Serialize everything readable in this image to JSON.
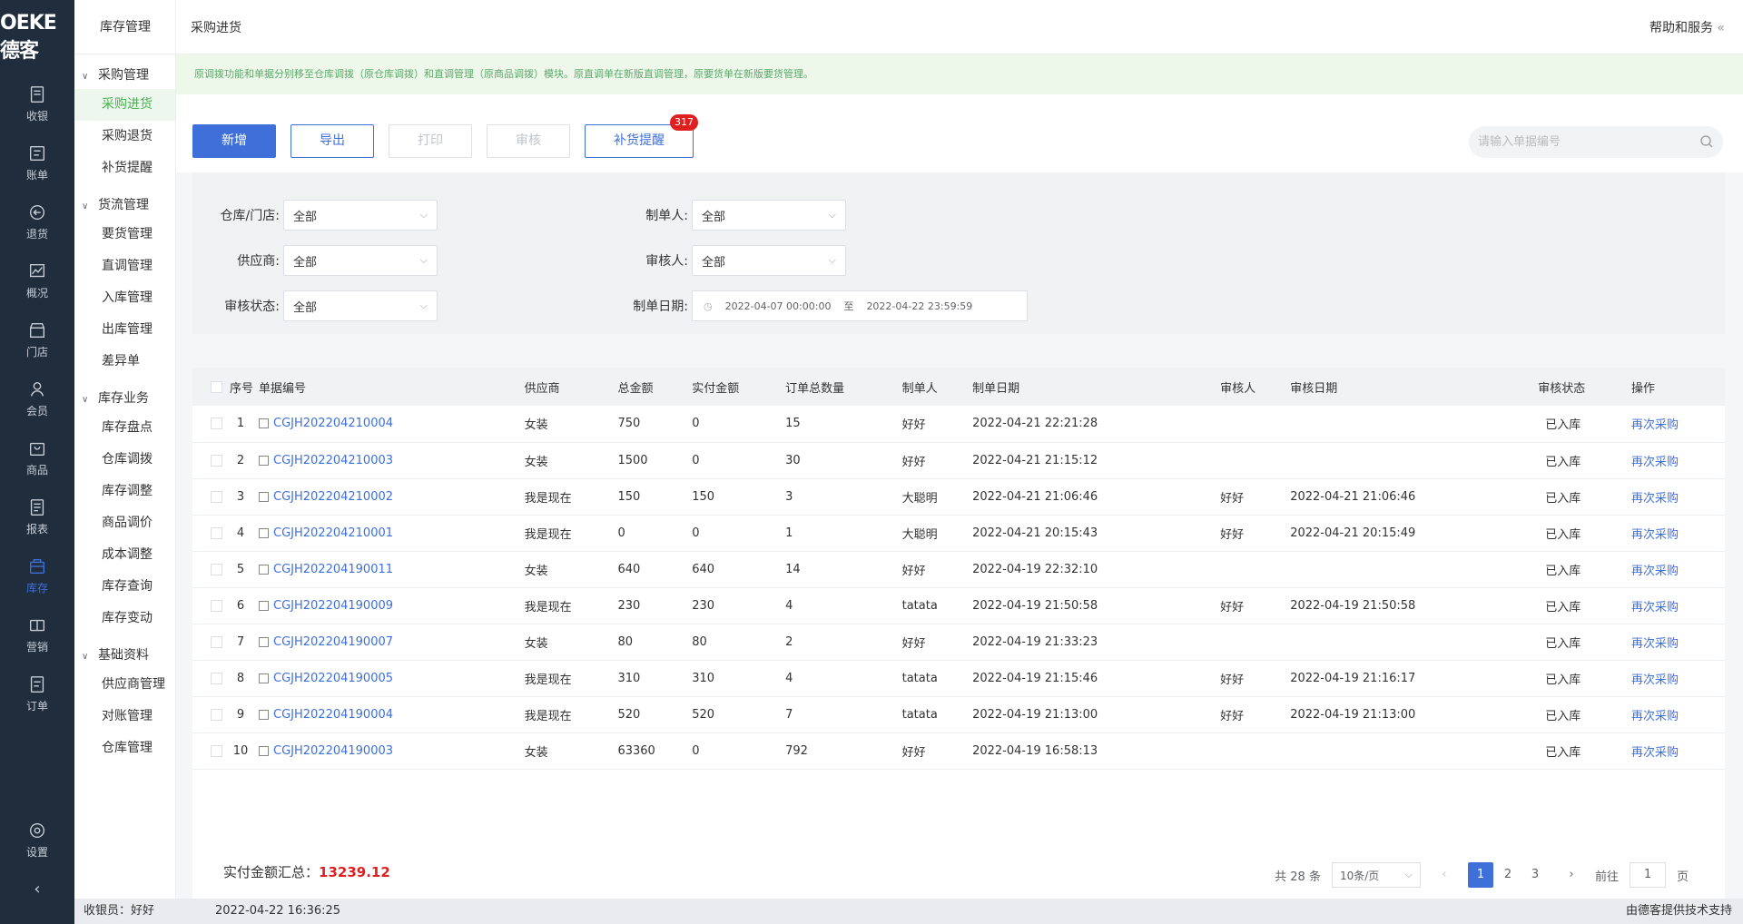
{
  "logo": "OEKE德客",
  "leftnav": [
    {
      "label": "收银",
      "icon": "cashier-icon"
    },
    {
      "label": "账单",
      "icon": "bill-icon"
    },
    {
      "label": "退货",
      "icon": "return-icon"
    },
    {
      "label": "概况",
      "icon": "overview-icon"
    },
    {
      "label": "门店",
      "icon": "store-icon"
    },
    {
      "label": "会员",
      "icon": "member-icon"
    },
    {
      "label": "商品",
      "icon": "goods-icon"
    },
    {
      "label": "报表",
      "icon": "report-icon"
    },
    {
      "label": "库存",
      "icon": "inventory-icon",
      "active": true
    },
    {
      "label": "营销",
      "icon": "marketing-icon"
    },
    {
      "label": "订单",
      "icon": "order-icon"
    }
  ],
  "settings_label": "设置",
  "submenu": {
    "title": "库存管理",
    "groups": [
      {
        "label": "采购管理",
        "items": [
          "采购进货",
          "采购退货",
          "补货提醒"
        ]
      },
      {
        "label": "货流管理",
        "items": [
          "要货管理",
          "直调管理",
          "入库管理",
          "出库管理",
          "差异单"
        ]
      },
      {
        "label": "库存业务",
        "items": [
          "库存盘点",
          "仓库调拨",
          "库存调整",
          "商品调价",
          "成本调整",
          "库存查询",
          "库存变动"
        ]
      },
      {
        "label": "基础资料",
        "items": [
          "供应商管理",
          "对账管理",
          "仓库管理"
        ]
      }
    ]
  },
  "topbar": {
    "title": "采购进货",
    "help": "帮助和服务"
  },
  "notice": "原调拨功能和单据分别移至仓库调拨（原仓库调拨）和直调管理（原商品调拨）模块。原直调单在新版直调管理，原要货单在新版要货管理。",
  "toolbar": {
    "add": "新增",
    "export": "导出",
    "print": "打印",
    "audit": "审核",
    "reminder": "补货提醒",
    "badge": "317"
  },
  "search": {
    "placeholder": "请输入单据编号"
  },
  "filters": {
    "warehouse_label": "仓库/门店:",
    "warehouse_value": "全部",
    "supplier_label": "供应商:",
    "supplier_value": "全部",
    "status_label": "审核状态:",
    "status_value": "全部",
    "creator_label": "制单人:",
    "creator_value": "全部",
    "auditor_label": "审核人:",
    "auditor_value": "全部",
    "date_label": "制单日期:",
    "date_start": "2022-04-07 00:00:00",
    "date_sep": "至",
    "date_end": "2022-04-22 23:59:59"
  },
  "table": {
    "headers": [
      "序号",
      "单据编号",
      "供应商",
      "总金额",
      "实付金额",
      "订单总数量",
      "制单人",
      "制单日期",
      "审核人",
      "审核日期",
      "审核状态",
      "操作"
    ],
    "rows": [
      [
        "1",
        "CGJH202204210004",
        "女装",
        "750",
        "0",
        "15",
        "好好",
        "2022-04-21 22:21:28",
        "",
        "",
        "已入库",
        "再次采购"
      ],
      [
        "2",
        "CGJH202204210003",
        "女装",
        "1500",
        "0",
        "30",
        "好好",
        "2022-04-21 21:15:12",
        "",
        "",
        "已入库",
        "再次采购"
      ],
      [
        "3",
        "CGJH202204210002",
        "我是现在",
        "150",
        "150",
        "3",
        "大聪明",
        "2022-04-21 21:06:46",
        "好好",
        "2022-04-21 21:06:46",
        "已入库",
        "再次采购"
      ],
      [
        "4",
        "CGJH202204210001",
        "我是现在",
        "0",
        "0",
        "1",
        "大聪明",
        "2022-04-21 20:15:43",
        "好好",
        "2022-04-21 20:15:49",
        "已入库",
        "再次采购"
      ],
      [
        "5",
        "CGJH202204190011",
        "女装",
        "640",
        "640",
        "14",
        "好好",
        "2022-04-19 22:32:10",
        "",
        "",
        "已入库",
        "再次采购"
      ],
      [
        "6",
        "CGJH202204190009",
        "我是现在",
        "230",
        "230",
        "4",
        "tatata",
        "2022-04-19 21:50:58",
        "好好",
        "2022-04-19 21:50:58",
        "已入库",
        "再次采购"
      ],
      [
        "7",
        "CGJH202204190007",
        "女装",
        "80",
        "80",
        "2",
        "好好",
        "2022-04-19 21:33:23",
        "",
        "",
        "已入库",
        "再次采购"
      ],
      [
        "8",
        "CGJH202204190005",
        "我是现在",
        "310",
        "310",
        "4",
        "tatata",
        "2022-04-19 21:15:46",
        "好好",
        "2022-04-19 21:16:17",
        "已入库",
        "再次采购"
      ],
      [
        "9",
        "CGJH202204190004",
        "我是现在",
        "520",
        "520",
        "7",
        "tatata",
        "2022-04-19 21:13:00",
        "好好",
        "2022-04-19 21:13:00",
        "已入库",
        "再次采购"
      ],
      [
        "10",
        "CGJH202204190003",
        "女装",
        "63360",
        "0",
        "792",
        "好好",
        "2022-04-19 16:58:13",
        "",
        "",
        "已入库",
        "再次采购"
      ]
    ]
  },
  "summary": {
    "label": "实付金额汇总：",
    "amount": "13239.12"
  },
  "pager": {
    "total": "共 28 条",
    "pagesize": "10条/页",
    "pages": [
      "1",
      "2",
      "3"
    ],
    "goto_label": "前往",
    "goto_value": "1",
    "page_unit": "页"
  },
  "footer": {
    "cashier": "收银员：好好",
    "datetime": "2022-04-22 16:36:25",
    "support": "由德客提供技术支持"
  }
}
